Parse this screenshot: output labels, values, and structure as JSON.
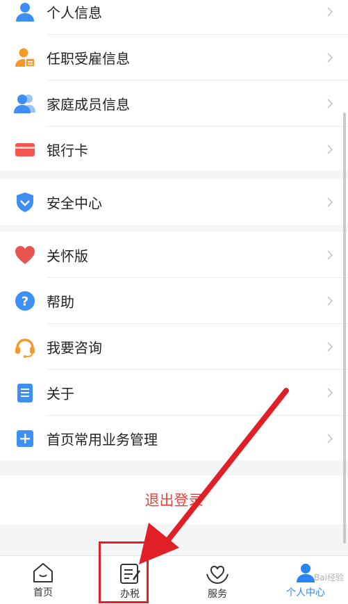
{
  "menu_groups": [
    {
      "items": [
        {
          "label": "个人信息",
          "icon": "person-icon"
        },
        {
          "label": "任职受雇信息",
          "icon": "employment-icon"
        },
        {
          "label": "家庭成员信息",
          "icon": "family-icon"
        },
        {
          "label": "银行卡",
          "icon": "bank-card-icon"
        }
      ]
    },
    {
      "items": [
        {
          "label": "安全中心",
          "icon": "shield-icon"
        }
      ]
    },
    {
      "items": [
        {
          "label": "关怀版",
          "icon": "heart-icon"
        },
        {
          "label": "帮助",
          "icon": "help-icon"
        },
        {
          "label": "我要咨询",
          "icon": "headset-icon"
        },
        {
          "label": "关于",
          "icon": "document-icon"
        },
        {
          "label": "首页常用业务管理",
          "icon": "plus-square-icon"
        }
      ]
    }
  ],
  "logout_label": "退出登录",
  "tabbar": {
    "tabs": [
      {
        "label": "首页",
        "icon": "home-icon"
      },
      {
        "label": "办税",
        "icon": "tax-edit-icon"
      },
      {
        "label": "服务",
        "icon": "service-heart-icon"
      },
      {
        "label": "个人中心",
        "icon": "profile-icon",
        "active": true
      }
    ]
  },
  "watermark": "Bai经验",
  "colors": {
    "accent_blue": "#2a86f4",
    "logout_red": "#e8423b",
    "annotation_red": "#e11f26"
  }
}
